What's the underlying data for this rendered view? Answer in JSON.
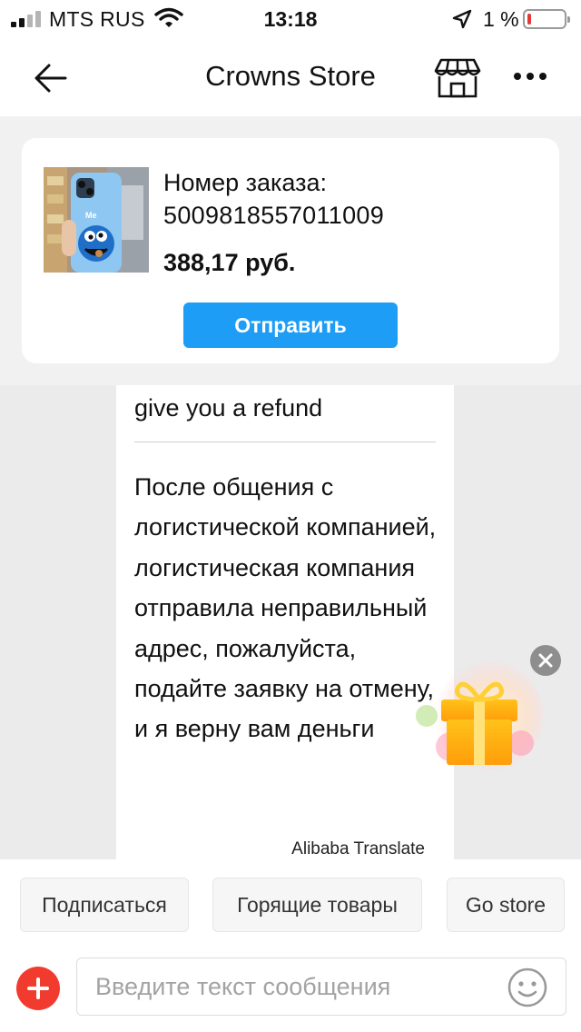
{
  "status_bar": {
    "carrier": "MTS RUS",
    "time": "13:18",
    "battery_percent": "1 %",
    "battery_level": 0.01,
    "icons": [
      "signal-icon",
      "wifi-icon",
      "location-arrow-icon",
      "battery-icon"
    ]
  },
  "nav": {
    "title": "Crowns Store",
    "icons": [
      "back-arrow-icon",
      "store-icon",
      "more-dots-icon"
    ]
  },
  "order": {
    "label": "Номер заказа:",
    "number": "5009818557011009",
    "price": "388,17 руб.",
    "send_label": "Отправить"
  },
  "chat": {
    "message_original": "give you a refund",
    "message_translated": "После общения с логистической компанией, логистическая компания отправила неправильный адрес, пожалуйста, подайте заявку на отмену, и я верну вам деньги",
    "translate_credit": "Alibaba Translate"
  },
  "quick_replies": [
    {
      "label": "Подписаться"
    },
    {
      "label": "Горящие товары"
    },
    {
      "label": "Go store"
    }
  ],
  "composer": {
    "placeholder": "Введите текст сообщения",
    "value": ""
  },
  "colors": {
    "accent_blue": "#1e9df6",
    "plus_red": "#f23b2f",
    "background_gray": "#f1f1f1"
  }
}
